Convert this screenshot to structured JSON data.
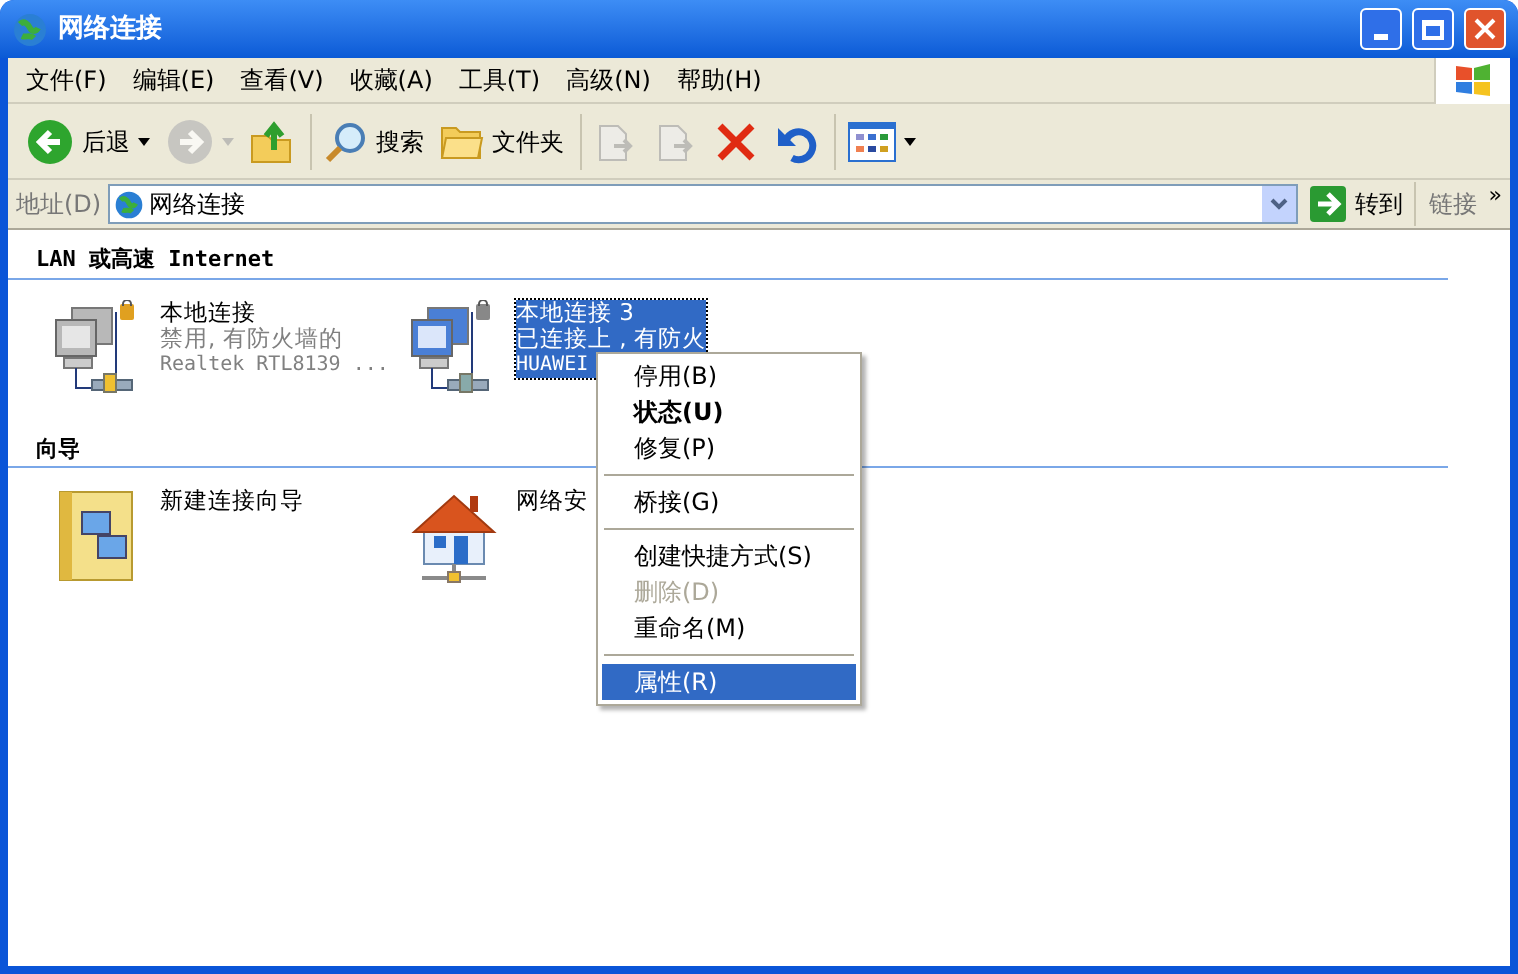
{
  "window": {
    "title": "网络连接"
  },
  "menu_bar": [
    "文件(F)",
    "编辑(E)",
    "查看(V)",
    "收藏(A)",
    "工具(T)",
    "高级(N)",
    "帮助(H)"
  ],
  "toolbar": [
    {
      "kind": "back",
      "label": "后退",
      "disabled": false
    },
    {
      "kind": "forward",
      "disabled": true
    },
    {
      "kind": "up",
      "disabled": false
    },
    {
      "kind": "search",
      "label": "搜索",
      "disabled": false
    },
    {
      "kind": "folders",
      "label": "文件夹",
      "disabled": false
    },
    {
      "kind": "move",
      "disabled": true
    },
    {
      "kind": "copy",
      "disabled": true
    },
    {
      "kind": "delete",
      "disabled": false
    },
    {
      "kind": "undo",
      "disabled": false
    },
    {
      "kind": "views",
      "disabled": false
    }
  ],
  "address_bar": {
    "label": "地址(D)",
    "value": "网络连接",
    "go": "转到",
    "links": "链接",
    "more": "»"
  },
  "sections": [
    {
      "heading": "LAN 或高速 Internet",
      "items": [
        {
          "kind": "lan",
          "name": "本地连接",
          "status": "禁用, 有防火墙的",
          "device": "Realtek RTL8139 ...",
          "enabled": false,
          "selected": false
        },
        {
          "kind": "lan",
          "name": "本地连接 3",
          "status": "已连接上 , 有防火",
          "device": "HUAWEI",
          "enabled": true,
          "selected": true
        }
      ]
    },
    {
      "heading": "向导",
      "items": [
        {
          "kind": "wizard",
          "name": "新建连接向导",
          "selected": false
        },
        {
          "kind": "home",
          "name": "网络安",
          "selected": false
        }
      ]
    }
  ],
  "context_menu": [
    {
      "kind": "item",
      "label": "停用(B)",
      "default": false,
      "disabled": false,
      "selected": false
    },
    {
      "kind": "item",
      "label": "状态(U)",
      "default": true,
      "disabled": false,
      "selected": false
    },
    {
      "kind": "item",
      "label": "修复(P)",
      "default": false,
      "disabled": false,
      "selected": false
    },
    {
      "kind": "separator"
    },
    {
      "kind": "item",
      "label": "桥接(G)",
      "default": false,
      "disabled": false,
      "selected": false
    },
    {
      "kind": "separator"
    },
    {
      "kind": "item",
      "label": "创建快捷方式(S)",
      "default": false,
      "disabled": false,
      "selected": false
    },
    {
      "kind": "item",
      "label": "删除(D)",
      "default": false,
      "disabled": true,
      "selected": false
    },
    {
      "kind": "item",
      "label": "重命名(M)",
      "default": false,
      "disabled": false,
      "selected": false
    },
    {
      "kind": "separator"
    },
    {
      "kind": "item",
      "label": "属性(R)",
      "default": false,
      "disabled": false,
      "selected": true
    }
  ]
}
